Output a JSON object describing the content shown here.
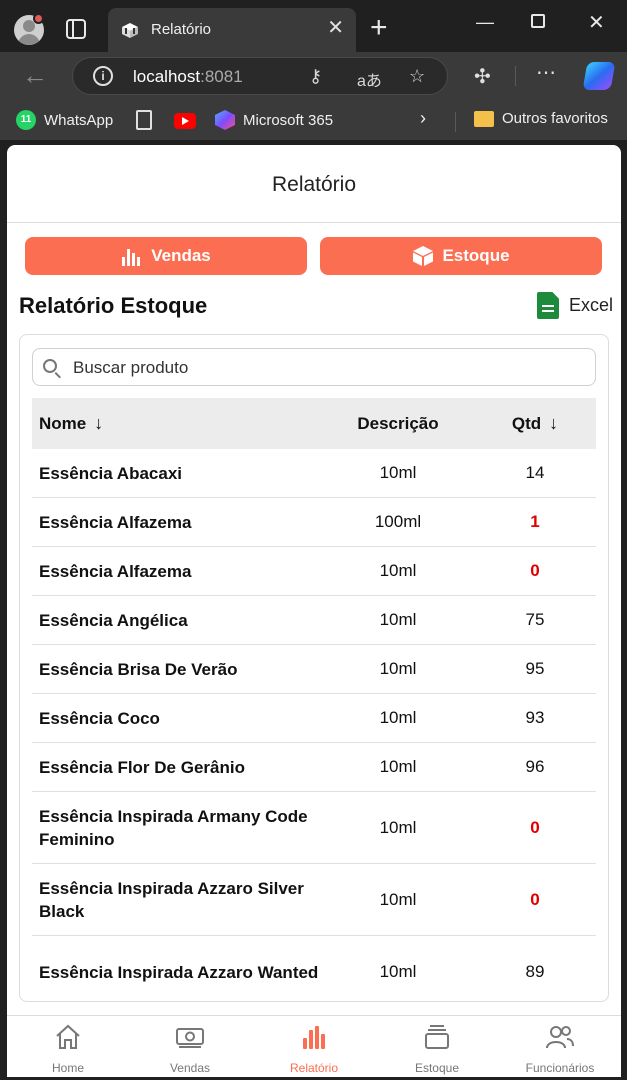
{
  "browser": {
    "tab_title": "Relatório",
    "url_host": "localhost",
    "url_port": ":8081",
    "bookmarks": [
      {
        "label": "WhatsApp",
        "icon": "whatsapp-icon",
        "badge": "11"
      },
      {
        "label": "",
        "icon": "document-icon"
      },
      {
        "label": "",
        "icon": "youtube-icon"
      },
      {
        "label": "Microsoft 365",
        "icon": "microsoft365-icon"
      },
      {
        "label": "Outros favoritos",
        "icon": "folder-icon"
      }
    ]
  },
  "app": {
    "header_title": "Relatório",
    "buttons": {
      "vendas": "Vendas",
      "estoque": "Estoque"
    },
    "section_title": "Relatório Estoque",
    "excel_label": "Excel",
    "search_placeholder": "Buscar produto",
    "columns": {
      "name": "Nome",
      "description": "Descrição",
      "qty": "Qtd"
    },
    "rows": [
      {
        "name": "Essência Abacaxi",
        "desc": "10ml",
        "qty": "14",
        "low": false
      },
      {
        "name": "Essência Alfazema",
        "desc": "100ml",
        "qty": "1",
        "low": true
      },
      {
        "name": "Essência Alfazema",
        "desc": "10ml",
        "qty": "0",
        "low": true
      },
      {
        "name": "Essência Angélica",
        "desc": "10ml",
        "qty": "75",
        "low": false
      },
      {
        "name": "Essência Brisa De Verão",
        "desc": "10ml",
        "qty": "95",
        "low": false
      },
      {
        "name": "Essência Coco",
        "desc": "10ml",
        "qty": "93",
        "low": false
      },
      {
        "name": "Essência Flor De Gerânio",
        "desc": "10ml",
        "qty": "96",
        "low": false
      },
      {
        "name": "Essência Inspirada Armany Code Feminino",
        "desc": "10ml",
        "qty": "0",
        "low": true
      },
      {
        "name": "Essência Inspirada Azzaro Silver Black",
        "desc": "10ml",
        "qty": "0",
        "low": true
      },
      {
        "name": "Essência Inspirada Azzaro Wanted",
        "desc": "10ml",
        "qty": "89",
        "low": false
      }
    ],
    "nav": [
      {
        "label": "Home",
        "icon": "home-icon",
        "active": false
      },
      {
        "label": "Vendas",
        "icon": "money-icon",
        "active": false
      },
      {
        "label": "Relatório",
        "icon": "chart-icon",
        "active": true
      },
      {
        "label": "Estoque",
        "icon": "box-stack-icon",
        "active": false
      },
      {
        "label": "Funcionários",
        "icon": "users-icon",
        "active": false
      }
    ]
  },
  "colors": {
    "accent": "#fb6e52",
    "low_stock": "#e00000",
    "excel": "#1e8a3c"
  }
}
